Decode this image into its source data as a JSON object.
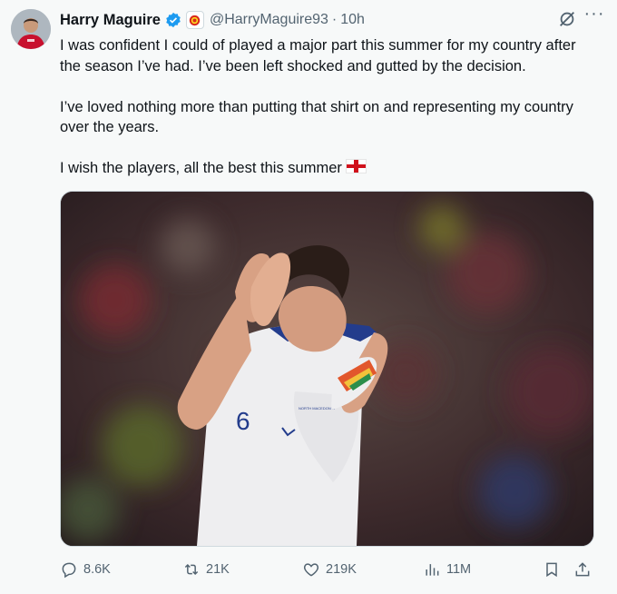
{
  "tweet": {
    "author_name": "Harry Maguire",
    "handle": "@HarryMaguire93",
    "separator": "·",
    "time": "10h",
    "more": "···",
    "paragraphs": [
      "I was confident I could of played a major part this summer for my country after the season I’ve had. I’ve been left shocked and gutted by the decision.",
      "I’ve loved nothing more than putting that shirt on and representing my country over the years.",
      "I wish the players, all the best this summer"
    ],
    "jersey_number": "6",
    "jersey_text": "NORTH MACEDONIA"
  },
  "actions": {
    "replies": "8.6K",
    "reposts": "21K",
    "likes": "219K",
    "views": "11M"
  },
  "icons": [
    "verified-icon",
    "club-badge-icon",
    "grok-icon",
    "more-icon",
    "reply-icon",
    "repost-icon",
    "like-icon",
    "views-icon",
    "bookmark-icon",
    "share-icon",
    "england-flag-icon"
  ],
  "colors": {
    "verified": "#1d9bf0",
    "secondary_text": "#536471",
    "flag_red": "#d0111b"
  }
}
